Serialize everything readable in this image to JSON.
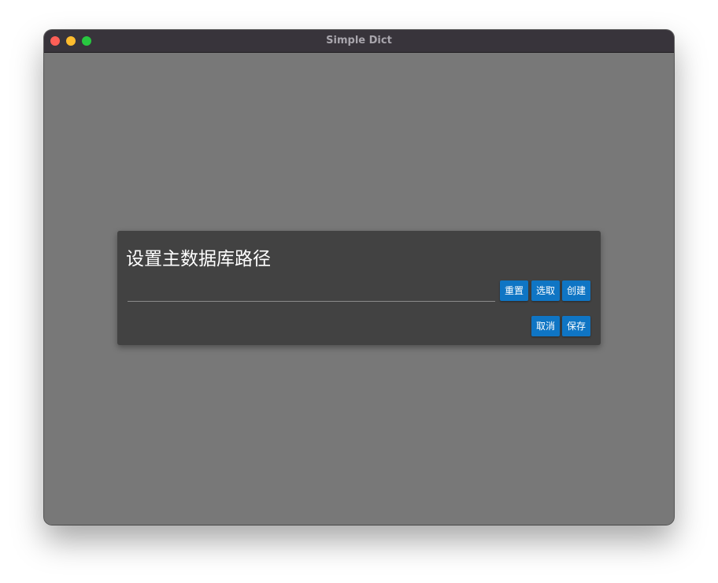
{
  "window": {
    "title": "Simple Dict"
  },
  "dialog": {
    "title": "设置主数据库路径",
    "path_input": {
      "value": "",
      "placeholder": ""
    },
    "buttons": {
      "reset": "重置",
      "select": "选取",
      "create": "创建",
      "cancel": "取消",
      "save": "保存"
    }
  },
  "colors": {
    "accent": "#0f75c4",
    "dialog_bg": "#424242",
    "backdrop": "#787878",
    "titlebar": "#38343b"
  }
}
